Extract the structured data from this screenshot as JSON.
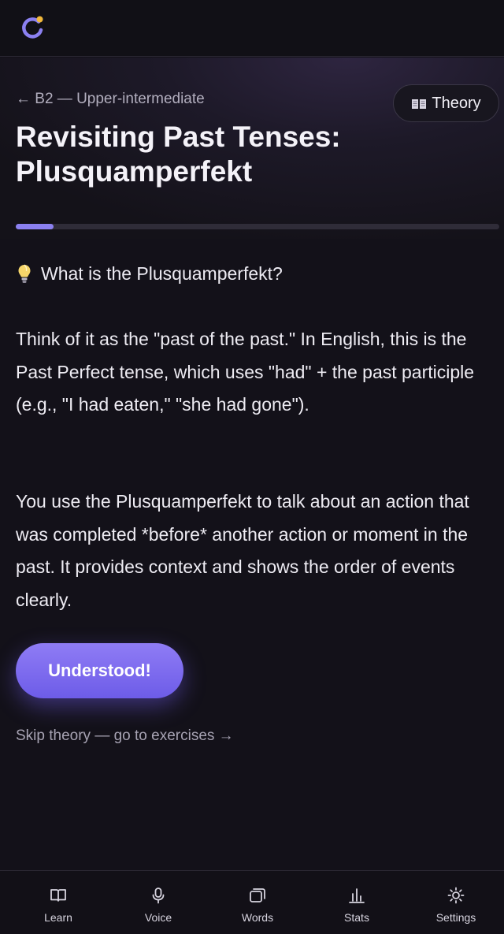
{
  "header": {
    "logo_icon": "app-logo-ring-icon",
    "accent_color": "#8B80F0",
    "logo_dot_color": "#F2B93B"
  },
  "lesson": {
    "breadcrumb": "← B2 — Upper-intermediate",
    "theory_button": "Theory",
    "theory_icon": "book-icon",
    "title": "Revisiting Past Tenses: Plusquamperfekt",
    "progress": 0.078
  },
  "content": {
    "question_icon": "lightbulb-icon",
    "question": "What is the Plusquamperfekt?",
    "paragraph_1": "Think of it as the \"past of the past.\" In English, this is the Past Perfect tense, which uses \"had\" + the past participle (e.g., \"I had eaten,\" \"she had gone\").",
    "paragraph_2": "You use the Plusquamperfekt to talk about an action that was completed *before* another action or moment in the past. It provides context and shows the order of events clearly."
  },
  "actions": {
    "understood": "Understood!",
    "skip": "Skip theory — go to exercises →"
  },
  "nav": {
    "items": [
      {
        "label": "Learn",
        "icon": "open-book-icon"
      },
      {
        "label": "Voice",
        "icon": "microphone-icon"
      },
      {
        "label": "Words",
        "icon": "cards-icon"
      },
      {
        "label": "Stats",
        "icon": "bar-chart-icon"
      },
      {
        "label": "Settings",
        "icon": "sun-gear-icon"
      }
    ]
  }
}
